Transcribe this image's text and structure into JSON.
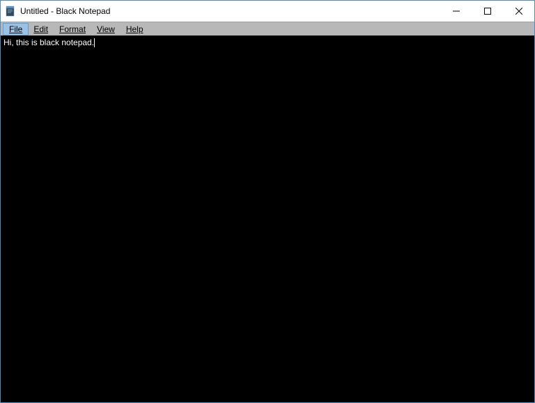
{
  "window": {
    "title": "Untitled - Black Notepad"
  },
  "menu": {
    "file": "File",
    "edit": "Edit",
    "format": "Format",
    "view": "View",
    "help": "Help"
  },
  "editor": {
    "content": "Hi, this is black notepad."
  }
}
